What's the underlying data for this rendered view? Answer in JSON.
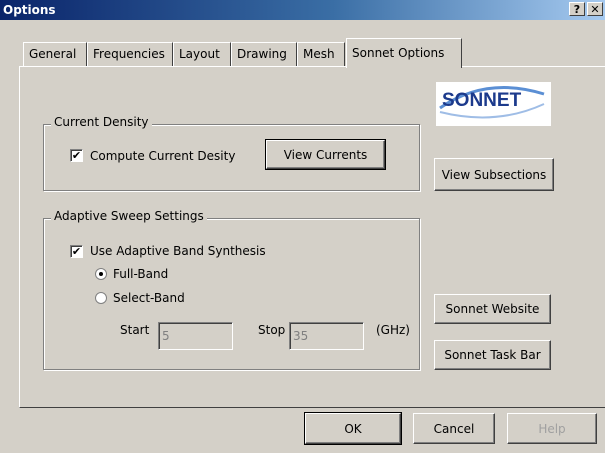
{
  "window": {
    "title": "Options",
    "help_btn": "?",
    "close_btn": "✕"
  },
  "tabs": [
    {
      "label": "General"
    },
    {
      "label": "Frequencies"
    },
    {
      "label": "Layout"
    },
    {
      "label": "Drawing"
    },
    {
      "label": "Mesh"
    },
    {
      "label": "Sonnet Options",
      "active": true
    }
  ],
  "logo": {
    "text": "SONNET"
  },
  "current_density": {
    "group_label": "Current Density",
    "checkbox_label": "Compute Current Desity",
    "checked": true,
    "view_currents_label": "View Currents"
  },
  "side_buttons": {
    "view_subsections": "View Subsections",
    "sonnet_website": "Sonnet Website",
    "sonnet_task_bar": "Sonnet Task Bar"
  },
  "adaptive": {
    "group_label": "Adaptive Sweep Settings",
    "checkbox_label": "Use Adaptive Band Synthesis",
    "checked": true,
    "full_band_label": "Full-Band",
    "select_band_label": "Select-Band",
    "selected": "Full-Band",
    "start_label": "Start",
    "start_value": "5",
    "stop_label": "Stop",
    "stop_value": "35",
    "unit_label": "(GHz)"
  },
  "footer": {
    "ok": "OK",
    "cancel": "Cancel",
    "help": "Help"
  },
  "check_mark": "✔"
}
